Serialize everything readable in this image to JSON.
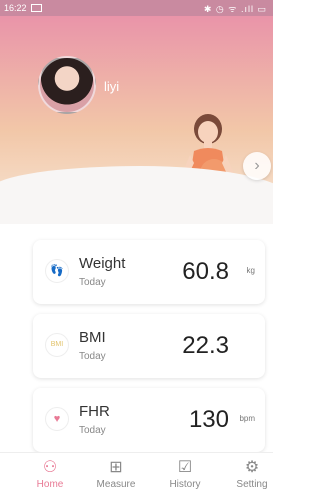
{
  "status": {
    "time": "16:22",
    "icons": "✱ ◷ ᯤ .ıll ▭"
  },
  "profile": {
    "name": "liyi"
  },
  "cards": [
    {
      "name": "Weight",
      "sub": "Today",
      "value": "60.8",
      "unit": "kg",
      "icon": "footprint-icon",
      "color": "#6cc4d9"
    },
    {
      "name": "BMI",
      "sub": "Today",
      "value": "22.3",
      "unit": "",
      "icon": "bmi-icon",
      "color": "#e2c36b"
    },
    {
      "name": "FHR",
      "sub": "Today",
      "value": "130",
      "unit": "bpm",
      "icon": "heart-icon",
      "color": "#e87a95"
    }
  ],
  "tabs": [
    {
      "label": "Home",
      "icon": "person-icon",
      "active": true
    },
    {
      "label": "Measure",
      "icon": "medkit-icon",
      "active": false
    },
    {
      "label": "History",
      "icon": "chart-icon",
      "active": false
    },
    {
      "label": "Setting",
      "icon": "gear-icon",
      "active": false
    }
  ],
  "colors": {
    "accent": "#e87a95",
    "hero_top": "#e994a9"
  }
}
